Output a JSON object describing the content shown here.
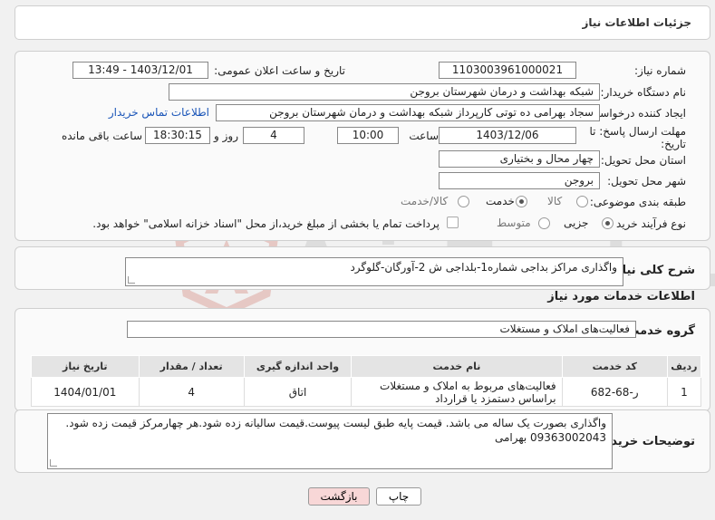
{
  "header": {
    "title": "جزئیات اطلاعات نیاز"
  },
  "form": {
    "need_number": {
      "label": "شماره نیاز:",
      "value": "1103003961000021"
    },
    "announce_datetime": {
      "label": "تاریخ و ساعت اعلان عمومی:",
      "value": "1403/12/01 - 13:49"
    },
    "buyer_org": {
      "label": "نام دستگاه خریدار:",
      "value": "شبکه بهداشت و درمان شهرستان بروجن"
    },
    "creator": {
      "label": "ایجاد کننده درخواست:",
      "value": "سجاد بهرامی ده توتی کارپرداز شبکه بهداشت و درمان شهرستان بروجن",
      "contact_link": "اطلاعات تماس خریدار"
    },
    "deadline": {
      "label_line1": "مهلت ارسال پاسخ: تا",
      "label_line2": "تاریخ:",
      "date": "1403/12/06",
      "time_label": "ساعت",
      "time": "10:00",
      "days": "4",
      "days_label": "روز و",
      "remaining_time": "18:30:15",
      "remaining_label": "ساعت باقی مانده"
    },
    "province": {
      "label": "استان محل تحویل:",
      "value": "چهار محال و بختیاری"
    },
    "city": {
      "label": "شهر محل تحویل:",
      "value": "بروجن"
    },
    "category": {
      "label": "طبقه بندی موضوعی:",
      "options": [
        "کالا",
        "خدمت",
        "کالا/خدمت"
      ],
      "selected": "خدمت"
    },
    "process": {
      "label": "نوع فرآیند خرید :",
      "options": [
        "جزیی",
        "متوسط"
      ],
      "selected": "جزیی",
      "checkbox_text": "پرداخت تمام یا بخشی از مبلغ خرید،از محل \"اسناد خزانه اسلامی\" خواهد بود."
    }
  },
  "description": {
    "label": "شرح کلی نیاز:",
    "value": "واگذاری مراکز بداجی شماره1-بلداجی ش 2-آورگان-گلوگرد"
  },
  "services": {
    "section_title": "اطلاعات خدمات مورد نیاز",
    "group_label": "گروه خدمت:",
    "group_value": "فعالیت‌های  املاک و مستغلات",
    "columns": [
      "ردیف",
      "کد خدمت",
      "نام خدمت",
      "واحد اندازه گیری",
      "تعداد / مقدار",
      "تاریخ نیاز"
    ],
    "rows": [
      {
        "index": "1",
        "code": "ر-68-682",
        "name": "فعالیت‌های مربوط به املاک و مستغلات براساس دستمزد یا قرارداد",
        "unit": "اتاق",
        "qty": "4",
        "date": "1404/01/01"
      }
    ]
  },
  "buyer_notes": {
    "label": "توضیحات خریدار:",
    "line1": "واگذاری بصورت یک ساله می باشد. قیمت پایه طبق لیست پیوست.قیمت سالیانه زده شود.هر چهارمرکز قیمت زده شود.",
    "line2": "09363002043 بهرامی"
  },
  "buttons": {
    "print": "چاپ",
    "back": "بازگشت"
  },
  "watermark": {
    "text": "AriaTender.neT"
  },
  "colors": {
    "link": "#1a55b8",
    "back_button_bg": "#f8d7d7",
    "watermark_red": "#c0392b"
  }
}
